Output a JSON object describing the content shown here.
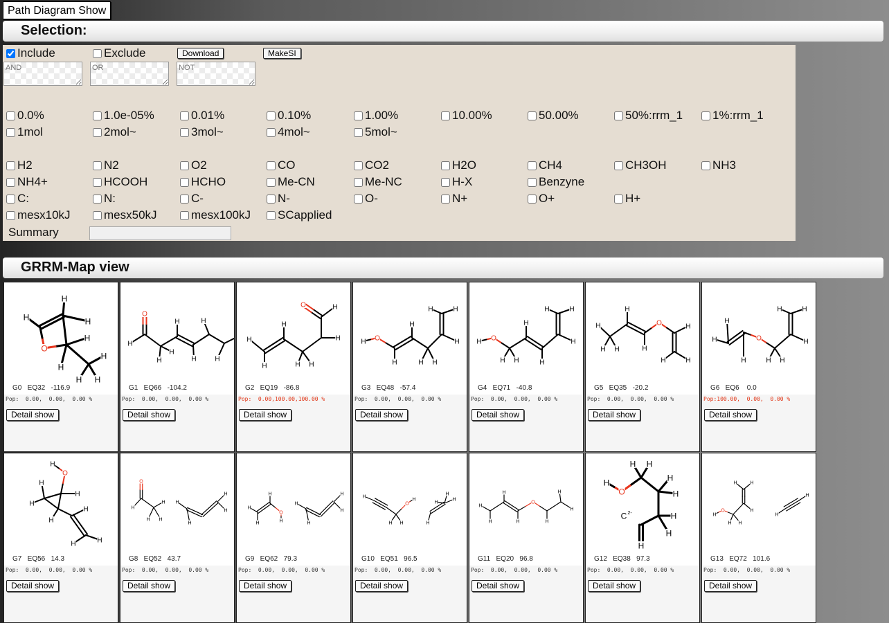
{
  "top_button": "Path Diagram Show",
  "selection": {
    "title": "Selection:",
    "include_label": "Include",
    "exclude_label": "Exclude",
    "download_label": "Download",
    "makesi_label": "MakeSI",
    "and_placeholder": "AND",
    "or_placeholder": "OR",
    "not_placeholder": "NOT",
    "population_filters": [
      "0.0%",
      "1.0e-05%",
      "0.01%",
      "0.10%",
      "1.00%",
      "10.00%",
      "50.00%",
      "50%:rrm_1",
      "1%:rrm_1"
    ],
    "mol_filters": [
      "1mol",
      "2mol~",
      "3mol~",
      "4mol~",
      "5mol~"
    ],
    "species_row1": [
      "H2",
      "N2",
      "O2",
      "CO",
      "CO2",
      "H2O",
      "CH4",
      "CH3OH",
      "NH3"
    ],
    "species_row2": [
      "NH4+",
      "HCOOH",
      "HCHO",
      "Me-CN",
      "Me-NC",
      "H-X",
      "Benzyne"
    ],
    "species_row3": [
      "C:",
      "N:",
      "C-",
      "N-",
      "O-",
      "N+",
      "O+",
      "H+"
    ],
    "species_row4": [
      "mesx10kJ",
      "mesx50kJ",
      "mesx100kJ",
      "SCapplied"
    ],
    "summary_label": "Summary"
  },
  "map": {
    "title": "GRRM-Map view",
    "detail_label": "Detail show",
    "cards": [
      {
        "label": "G0   EQ32   -116.9",
        "pop": "Pop:  0.00,  0.00,  0.00 %",
        "pop_highlight": false
      },
      {
        "label": "G1   EQ66   -104.2",
        "pop": "Pop:  0.00,  0.00,  0.00 %",
        "pop_highlight": false
      },
      {
        "label": "G2   EQ19   -86.8",
        "pop": "Pop:  0.00,100.00,100.00 %",
        "pop_highlight": true
      },
      {
        "label": "G3   EQ48   -57.4",
        "pop": "Pop:  0.00,  0.00,  0.00 %",
        "pop_highlight": false
      },
      {
        "label": "G4   EQ71   -40.8",
        "pop": "Pop:  0.00,  0.00,  0.00 %",
        "pop_highlight": false
      },
      {
        "label": "G5   EQ35   -20.2",
        "pop": "Pop:  0.00,  0.00,  0.00 %",
        "pop_highlight": false
      },
      {
        "label": "G6   EQ6    0.0",
        "pop": "Pop:100.00,  0.00,  0.00 %",
        "pop_highlight": true
      },
      {
        "label": "G7   EQ56   14.3",
        "pop": "Pop:  0.00,  0.00,  0.00 %",
        "pop_highlight": false
      },
      {
        "label": "G8   EQ52   43.7",
        "pop": "Pop:  0.00,  0.00,  0.00 %",
        "pop_highlight": false
      },
      {
        "label": "G9   EQ62   79.3",
        "pop": "Pop:  0.00,  0.00,  0.00 %",
        "pop_highlight": false
      },
      {
        "label": "G10   EQ51   96.5",
        "pop": "Pop:  0.00,  0.00,  0.00 %",
        "pop_highlight": false
      },
      {
        "label": "G11   EQ20   96.8",
        "pop": "Pop:  0.00,  0.00,  0.00 %",
        "pop_highlight": false
      },
      {
        "label": "G12   EQ38   97.3",
        "pop": "Pop:  0.00,  0.00,  0.00 %",
        "pop_highlight": false
      },
      {
        "label": "G13   EQ72   101.6",
        "pop": "Pop:  0.00,  0.00,  0.00 %",
        "pop_highlight": false
      }
    ]
  }
}
